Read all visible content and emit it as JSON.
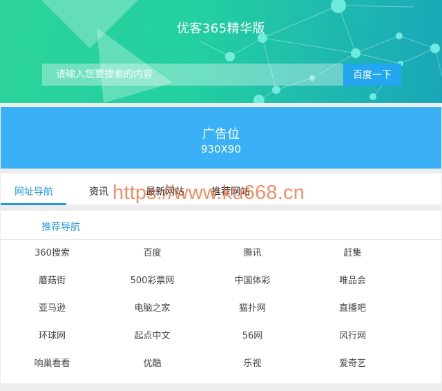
{
  "header": {
    "title": "优客365精华版",
    "search_placeholder": "请输入您要搜索的内容",
    "search_button": "百度一下"
  },
  "ad": {
    "title": "广告位",
    "size": "930X90"
  },
  "tabs": [
    {
      "label": "网址导航"
    },
    {
      "label": "资讯"
    },
    {
      "label": "最新网站"
    },
    {
      "label": "推荐网站"
    }
  ],
  "section": {
    "title": "推荐导航",
    "links": [
      "360搜索",
      "百度",
      "腾讯",
      "赶集",
      "蘑菇街",
      "500彩票网",
      "中国体彩",
      "唯品会",
      "亚马逊",
      "电脑之家",
      "猫扑网",
      "直播吧",
      "环球网",
      "起点中文",
      "56网",
      "风行网",
      "响巢看看",
      "优酷",
      "乐视",
      "爱奇艺"
    ]
  },
  "watermark": "https://www.ku668.cn",
  "colors": {
    "accent_blue": "#2a97de",
    "ad_blue": "#3ab1f6",
    "hero_green": "#2cd39b",
    "hero_teal": "#19a6b8",
    "watermark": "#ee6e3c"
  }
}
